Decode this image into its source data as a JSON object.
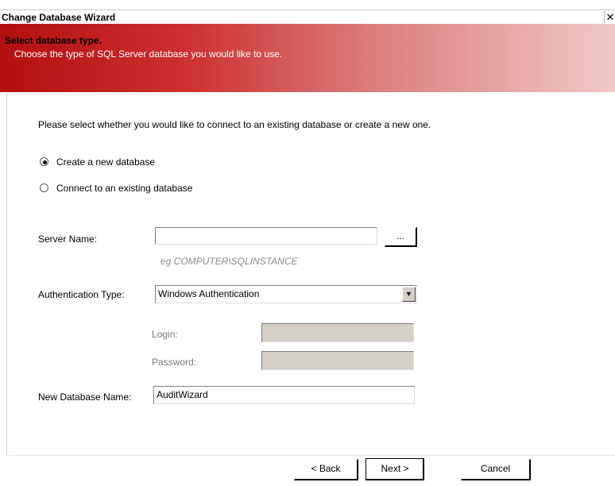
{
  "window": {
    "title": "Change Database Wizard",
    "close_glyph": "✕"
  },
  "banner": {
    "heading": "Select database type.",
    "subheading": "Choose the type of SQL Server database you would like to use."
  },
  "main": {
    "instruction": "Please select whether you would like to connect to an existing database or create a new one.",
    "radio_options": [
      {
        "label": "Create a new database",
        "selected": true
      },
      {
        "label": "Connect to an existing database",
        "selected": false
      }
    ],
    "server_name": {
      "label": "Server Name:",
      "value": "",
      "browse_label": "...",
      "hint": "eg COMPUTER\\SQLINSTANCE"
    },
    "authentication": {
      "label": "Authentication Type:",
      "selected": "Windows Authentication"
    },
    "login": {
      "label": "Login:",
      "value": ""
    },
    "password": {
      "label": "Password:",
      "value": ""
    },
    "new_database": {
      "label": "New Database Name:",
      "value": "AuditWizard"
    }
  },
  "footer": {
    "back_label": "< Back",
    "next_label": "Next >",
    "cancel_label": "Cancel"
  },
  "colors": {
    "banner_start": "#b40f0f",
    "banner_end": "#f0c8c8",
    "disabled_field": "#d4d0c8"
  }
}
